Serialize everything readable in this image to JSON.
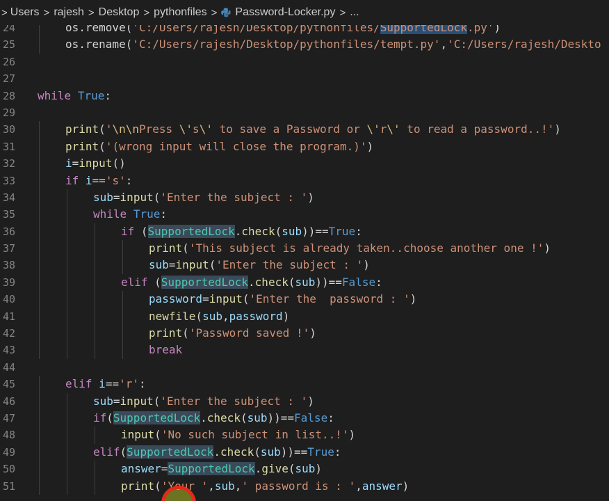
{
  "breadcrumb": {
    "items": [
      "Users",
      "rajesh",
      "Desktop",
      "pythonfiles",
      "Password-Locker.py",
      "..."
    ],
    "separator": ">"
  },
  "editor": {
    "lines": [
      {
        "num": "24",
        "indent": 1,
        "tokens": [
          [
            "os.remove(",
            ""
          ],
          [
            "'C:/Users/rajesh/Desktop/pythonfiles/",
            "s"
          ],
          [
            "SupportedLock",
            "s hl"
          ],
          [
            ".py'",
            "s"
          ],
          [
            ")",
            ""
          ]
        ]
      },
      {
        "num": "25",
        "indent": 1,
        "tokens": [
          [
            "os.rename(",
            ""
          ],
          [
            "'C:/Users/rajesh/Desktop/pythonfiles/tempt.py'",
            "s"
          ],
          [
            ",",
            ""
          ],
          [
            "'C:/Users/rajesh/Deskto",
            "s"
          ]
        ]
      },
      {
        "num": "26",
        "indent": 0,
        "tokens": []
      },
      {
        "num": "27",
        "indent": 0,
        "tokens": []
      },
      {
        "num": "28",
        "indent": 0,
        "tokens": [
          [
            "while",
            "k"
          ],
          [
            " ",
            ""
          ],
          [
            "True",
            "kb"
          ],
          [
            ":",
            ""
          ]
        ]
      },
      {
        "num": "29",
        "indent": 0,
        "tokens": []
      },
      {
        "num": "30",
        "indent": 1,
        "tokens": [
          [
            "print",
            "f"
          ],
          [
            "(",
            ""
          ],
          [
            "'",
            "s"
          ],
          [
            "\\n\\n",
            "e"
          ],
          [
            "Press ",
            "s"
          ],
          [
            "\\'",
            "e"
          ],
          [
            "s",
            "s"
          ],
          [
            "\\'",
            "e"
          ],
          [
            " to save a Password or ",
            "s"
          ],
          [
            "\\'",
            "e"
          ],
          [
            "r",
            "s"
          ],
          [
            "\\'",
            "e"
          ],
          [
            " to read a password..!'",
            "s"
          ],
          [
            ")",
            ""
          ]
        ]
      },
      {
        "num": "31",
        "indent": 1,
        "tokens": [
          [
            "print",
            "f"
          ],
          [
            "(",
            ""
          ],
          [
            "'(wrong input will close the program.)'",
            "s"
          ],
          [
            ")",
            ""
          ]
        ]
      },
      {
        "num": "32",
        "indent": 1,
        "tokens": [
          [
            "i",
            "v"
          ],
          [
            "=",
            ""
          ],
          [
            "input",
            "f"
          ],
          [
            "()",
            ""
          ]
        ]
      },
      {
        "num": "33",
        "indent": 1,
        "tokens": [
          [
            "if",
            "k"
          ],
          [
            " ",
            ""
          ],
          [
            "i",
            "v"
          ],
          [
            "==",
            ""
          ],
          [
            "'s'",
            "s"
          ],
          [
            ":",
            ""
          ]
        ]
      },
      {
        "num": "34",
        "indent": 2,
        "tokens": [
          [
            "sub",
            "v"
          ],
          [
            "=",
            ""
          ],
          [
            "input",
            "f"
          ],
          [
            "(",
            ""
          ],
          [
            "'Enter the subject : '",
            "s"
          ],
          [
            ")",
            ""
          ]
        ]
      },
      {
        "num": "35",
        "indent": 2,
        "tokens": [
          [
            "while",
            "k"
          ],
          [
            " ",
            ""
          ],
          [
            "True",
            "kb"
          ],
          [
            ":",
            ""
          ]
        ]
      },
      {
        "num": "36",
        "indent": 3,
        "tokens": [
          [
            "if",
            "k"
          ],
          [
            " (",
            ""
          ],
          [
            "SupportedLock",
            "cl hlw"
          ],
          [
            ".",
            ""
          ],
          [
            "check",
            "f"
          ],
          [
            "(",
            ""
          ],
          [
            "sub",
            "v"
          ],
          [
            "))==",
            ""
          ],
          [
            "True",
            "kb"
          ],
          [
            ":",
            ""
          ]
        ]
      },
      {
        "num": "37",
        "indent": 4,
        "tokens": [
          [
            "print",
            "f"
          ],
          [
            "(",
            ""
          ],
          [
            "'This subject is already taken..choose another one !'",
            "s"
          ],
          [
            ")",
            ""
          ]
        ]
      },
      {
        "num": "38",
        "indent": 4,
        "tokens": [
          [
            "sub",
            "v"
          ],
          [
            "=",
            ""
          ],
          [
            "input",
            "f"
          ],
          [
            "(",
            ""
          ],
          [
            "'Enter the subject : '",
            "s"
          ],
          [
            ")",
            ""
          ]
        ]
      },
      {
        "num": "39",
        "indent": 3,
        "tokens": [
          [
            "elif",
            "k"
          ],
          [
            " (",
            ""
          ],
          [
            "SupportedLock",
            "cl hlw"
          ],
          [
            ".",
            ""
          ],
          [
            "check",
            "f"
          ],
          [
            "(",
            ""
          ],
          [
            "sub",
            "v"
          ],
          [
            "))==",
            ""
          ],
          [
            "False",
            "kb"
          ],
          [
            ":",
            ""
          ]
        ]
      },
      {
        "num": "40",
        "indent": 4,
        "tokens": [
          [
            "password",
            "v"
          ],
          [
            "=",
            ""
          ],
          [
            "input",
            "f"
          ],
          [
            "(",
            ""
          ],
          [
            "'Enter the  password : '",
            "s"
          ],
          [
            ")",
            ""
          ]
        ]
      },
      {
        "num": "41",
        "indent": 4,
        "tokens": [
          [
            "newfile",
            "f"
          ],
          [
            "(",
            ""
          ],
          [
            "sub",
            "v"
          ],
          [
            ",",
            ""
          ],
          [
            "password",
            "v"
          ],
          [
            ")",
            ""
          ]
        ]
      },
      {
        "num": "42",
        "indent": 4,
        "tokens": [
          [
            "print",
            "f"
          ],
          [
            "(",
            ""
          ],
          [
            "'Password saved !'",
            "s"
          ],
          [
            ")",
            ""
          ]
        ]
      },
      {
        "num": "43",
        "indent": 4,
        "tokens": [
          [
            "break",
            "k"
          ]
        ]
      },
      {
        "num": "44",
        "indent": 0,
        "tokens": []
      },
      {
        "num": "45",
        "indent": 1,
        "tokens": [
          [
            "elif",
            "k"
          ],
          [
            " ",
            ""
          ],
          [
            "i",
            "v"
          ],
          [
            "==",
            ""
          ],
          [
            "'r'",
            "s"
          ],
          [
            ":",
            ""
          ]
        ]
      },
      {
        "num": "46",
        "indent": 2,
        "tokens": [
          [
            "sub",
            "v"
          ],
          [
            "=",
            ""
          ],
          [
            "input",
            "f"
          ],
          [
            "(",
            ""
          ],
          [
            "'Enter the subject : '",
            "s"
          ],
          [
            ")",
            ""
          ]
        ]
      },
      {
        "num": "47",
        "indent": 2,
        "tokens": [
          [
            "if",
            "k"
          ],
          [
            "(",
            ""
          ],
          [
            "SupportedLock",
            "cl hlw"
          ],
          [
            ".",
            ""
          ],
          [
            "check",
            "f"
          ],
          [
            "(",
            ""
          ],
          [
            "sub",
            "v"
          ],
          [
            "))==",
            ""
          ],
          [
            "False",
            "kb"
          ],
          [
            ":",
            ""
          ]
        ]
      },
      {
        "num": "48",
        "indent": 3,
        "tokens": [
          [
            "input",
            "f"
          ],
          [
            "(",
            ""
          ],
          [
            "'No such subject in list..!'",
            "s"
          ],
          [
            ")",
            ""
          ]
        ]
      },
      {
        "num": "49",
        "indent": 2,
        "tokens": [
          [
            "elif",
            "k"
          ],
          [
            "(",
            ""
          ],
          [
            "SupportedLock",
            "cl hlw"
          ],
          [
            ".",
            ""
          ],
          [
            "check",
            "f"
          ],
          [
            "(",
            ""
          ],
          [
            "sub",
            "v"
          ],
          [
            "))==",
            ""
          ],
          [
            "True",
            "kb"
          ],
          [
            ":",
            ""
          ]
        ]
      },
      {
        "num": "50",
        "indent": 3,
        "tokens": [
          [
            "answer",
            "v"
          ],
          [
            "=",
            ""
          ],
          [
            "SupportedLock",
            "cl hlw"
          ],
          [
            ".",
            ""
          ],
          [
            "give",
            "f"
          ],
          [
            "(",
            ""
          ],
          [
            "sub",
            "v"
          ],
          [
            ")",
            ""
          ]
        ]
      },
      {
        "num": "51",
        "indent": 3,
        "tokens": [
          [
            "print",
            "f"
          ],
          [
            "(",
            ""
          ],
          [
            "'Your '",
            "s"
          ],
          [
            ",",
            ""
          ],
          [
            "sub",
            "v"
          ],
          [
            ",",
            ""
          ],
          [
            "' password is : '",
            "s"
          ],
          [
            ",",
            ""
          ],
          [
            "answer",
            "v"
          ],
          [
            ")",
            ""
          ]
        ]
      }
    ]
  },
  "colors": {
    "background": "#1e1e1e",
    "keyword": "#c586c0",
    "constant": "#569cd6",
    "function": "#dcdcaa",
    "string": "#ce9178",
    "class": "#4ec9b0",
    "variable": "#9cdcfe",
    "line_number": "#858585",
    "cursor_ring": "#e32b17"
  }
}
